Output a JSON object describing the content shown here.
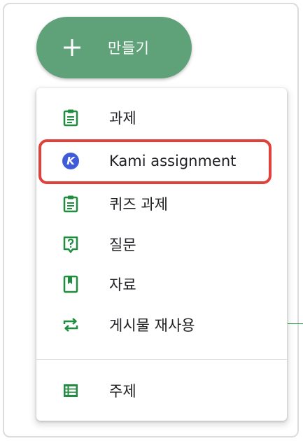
{
  "create_button": {
    "label": "만들기",
    "icon": "plus-icon"
  },
  "menu": {
    "items": [
      {
        "label": "과제",
        "icon": "assignment-clipboard-icon"
      },
      {
        "label": "Kami assignment",
        "icon": "kami-logo-icon",
        "icon_letter": "K"
      },
      {
        "label": "퀴즈 과제",
        "icon": "quiz-assignment-icon"
      },
      {
        "label": "질문",
        "icon": "question-icon"
      },
      {
        "label": "자료",
        "icon": "material-icon"
      },
      {
        "label": "게시물 재사용",
        "icon": "reuse-post-icon"
      },
      {
        "label": "주제",
        "icon": "topic-list-icon"
      }
    ]
  },
  "colors": {
    "accent_green": "#1e8e3e",
    "button_green": "#5fa27a",
    "kami_blue": "#3f5bd9",
    "highlight_red": "#e0423b"
  }
}
